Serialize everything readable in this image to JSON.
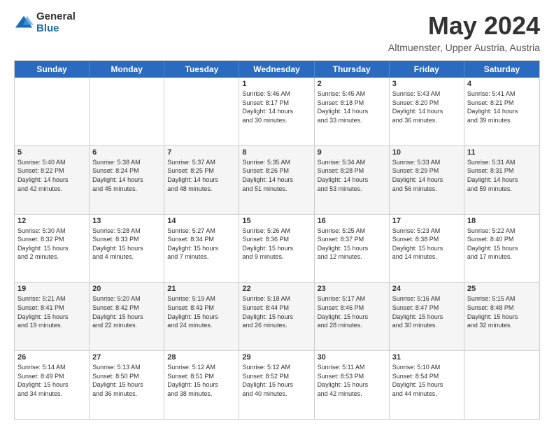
{
  "logo": {
    "general": "General",
    "blue": "Blue"
  },
  "title": {
    "month": "May 2024",
    "location": "Altmuenster, Upper Austria, Austria"
  },
  "header": {
    "days": [
      "Sunday",
      "Monday",
      "Tuesday",
      "Wednesday",
      "Thursday",
      "Friday",
      "Saturday"
    ]
  },
  "weeks": [
    {
      "shaded": false,
      "cells": [
        {
          "day": "",
          "text": ""
        },
        {
          "day": "",
          "text": ""
        },
        {
          "day": "",
          "text": ""
        },
        {
          "day": "1",
          "text": "Sunrise: 5:46 AM\nSunset: 8:17 PM\nDaylight: 14 hours\nand 30 minutes."
        },
        {
          "day": "2",
          "text": "Sunrise: 5:45 AM\nSunset: 8:18 PM\nDaylight: 14 hours\nand 33 minutes."
        },
        {
          "day": "3",
          "text": "Sunrise: 5:43 AM\nSunset: 8:20 PM\nDaylight: 14 hours\nand 36 minutes."
        },
        {
          "day": "4",
          "text": "Sunrise: 5:41 AM\nSunset: 8:21 PM\nDaylight: 14 hours\nand 39 minutes."
        }
      ]
    },
    {
      "shaded": true,
      "cells": [
        {
          "day": "5",
          "text": "Sunrise: 5:40 AM\nSunset: 8:22 PM\nDaylight: 14 hours\nand 42 minutes."
        },
        {
          "day": "6",
          "text": "Sunrise: 5:38 AM\nSunset: 8:24 PM\nDaylight: 14 hours\nand 45 minutes."
        },
        {
          "day": "7",
          "text": "Sunrise: 5:37 AM\nSunset: 8:25 PM\nDaylight: 14 hours\nand 48 minutes."
        },
        {
          "day": "8",
          "text": "Sunrise: 5:35 AM\nSunset: 8:26 PM\nDaylight: 14 hours\nand 51 minutes."
        },
        {
          "day": "9",
          "text": "Sunrise: 5:34 AM\nSunset: 8:28 PM\nDaylight: 14 hours\nand 53 minutes."
        },
        {
          "day": "10",
          "text": "Sunrise: 5:33 AM\nSunset: 8:29 PM\nDaylight: 14 hours\nand 56 minutes."
        },
        {
          "day": "11",
          "text": "Sunrise: 5:31 AM\nSunset: 8:31 PM\nDaylight: 14 hours\nand 59 minutes."
        }
      ]
    },
    {
      "shaded": false,
      "cells": [
        {
          "day": "12",
          "text": "Sunrise: 5:30 AM\nSunset: 8:32 PM\nDaylight: 15 hours\nand 2 minutes."
        },
        {
          "day": "13",
          "text": "Sunrise: 5:28 AM\nSunset: 8:33 PM\nDaylight: 15 hours\nand 4 minutes."
        },
        {
          "day": "14",
          "text": "Sunrise: 5:27 AM\nSunset: 8:34 PM\nDaylight: 15 hours\nand 7 minutes."
        },
        {
          "day": "15",
          "text": "Sunrise: 5:26 AM\nSunset: 8:36 PM\nDaylight: 15 hours\nand 9 minutes."
        },
        {
          "day": "16",
          "text": "Sunrise: 5:25 AM\nSunset: 8:37 PM\nDaylight: 15 hours\nand 12 minutes."
        },
        {
          "day": "17",
          "text": "Sunrise: 5:23 AM\nSunset: 8:38 PM\nDaylight: 15 hours\nand 14 minutes."
        },
        {
          "day": "18",
          "text": "Sunrise: 5:22 AM\nSunset: 8:40 PM\nDaylight: 15 hours\nand 17 minutes."
        }
      ]
    },
    {
      "shaded": true,
      "cells": [
        {
          "day": "19",
          "text": "Sunrise: 5:21 AM\nSunset: 8:41 PM\nDaylight: 15 hours\nand 19 minutes."
        },
        {
          "day": "20",
          "text": "Sunrise: 5:20 AM\nSunset: 8:42 PM\nDaylight: 15 hours\nand 22 minutes."
        },
        {
          "day": "21",
          "text": "Sunrise: 5:19 AM\nSunset: 8:43 PM\nDaylight: 15 hours\nand 24 minutes."
        },
        {
          "day": "22",
          "text": "Sunrise: 5:18 AM\nSunset: 8:44 PM\nDaylight: 15 hours\nand 26 minutes."
        },
        {
          "day": "23",
          "text": "Sunrise: 5:17 AM\nSunset: 8:46 PM\nDaylight: 15 hours\nand 28 minutes."
        },
        {
          "day": "24",
          "text": "Sunrise: 5:16 AM\nSunset: 8:47 PM\nDaylight: 15 hours\nand 30 minutes."
        },
        {
          "day": "25",
          "text": "Sunrise: 5:15 AM\nSunset: 8:48 PM\nDaylight: 15 hours\nand 32 minutes."
        }
      ]
    },
    {
      "shaded": false,
      "cells": [
        {
          "day": "26",
          "text": "Sunrise: 5:14 AM\nSunset: 8:49 PM\nDaylight: 15 hours\nand 34 minutes."
        },
        {
          "day": "27",
          "text": "Sunrise: 5:13 AM\nSunset: 8:50 PM\nDaylight: 15 hours\nand 36 minutes."
        },
        {
          "day": "28",
          "text": "Sunrise: 5:12 AM\nSunset: 8:51 PM\nDaylight: 15 hours\nand 38 minutes."
        },
        {
          "day": "29",
          "text": "Sunrise: 5:12 AM\nSunset: 8:52 PM\nDaylight: 15 hours\nand 40 minutes."
        },
        {
          "day": "30",
          "text": "Sunrise: 5:11 AM\nSunset: 8:53 PM\nDaylight: 15 hours\nand 42 minutes."
        },
        {
          "day": "31",
          "text": "Sunrise: 5:10 AM\nSunset: 8:54 PM\nDaylight: 15 hours\nand 44 minutes."
        },
        {
          "day": "",
          "text": ""
        }
      ]
    }
  ]
}
